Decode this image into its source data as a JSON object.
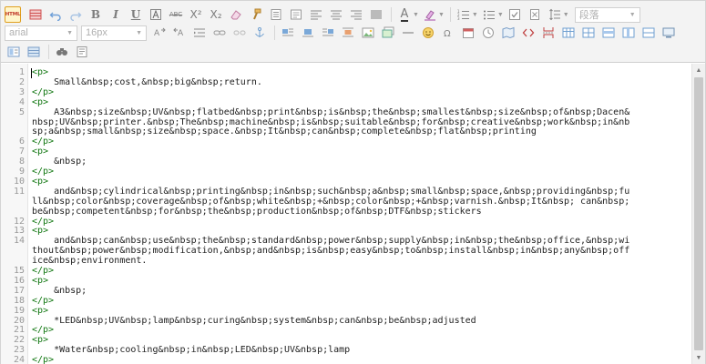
{
  "toolbar": {
    "html_label": "HTML",
    "font_family_value": "arial",
    "font_size_value": "16px",
    "paragraph_value": "段落",
    "row1_icons": [
      "table-icon",
      "undo-icon",
      "redo-icon",
      "bold-icon",
      "italic-icon",
      "underline-icon",
      "font-border-icon",
      "strikethrough-icon",
      "superscript-icon",
      "subscript-icon",
      "eraser-icon",
      "format-brush-icon",
      "auto-typeset-icon",
      "block-quote-icon",
      "align-left-icon",
      "align-center-icon",
      "align-right-icon",
      "align-justify-icon",
      "font-color-icon",
      "highlight-color-icon",
      "ordered-list-icon",
      "unordered-list-icon",
      "select-all-icon",
      "clear-doc-icon",
      "line-height-icon"
    ],
    "row1_glyphs": {
      "bold": "B",
      "italic": "I",
      "underline": "U",
      "strike": "ABC",
      "sup": "X²",
      "sub": "X₂",
      "fontcolor": "A"
    },
    "row2_icons": [
      "direction-ltr-icon",
      "direction-rtl-icon",
      "indent-icon",
      "link-icon",
      "unlink-icon",
      "anchor-icon",
      "image-left-icon",
      "image-none-icon",
      "image-right-icon",
      "image-center-icon",
      "insert-image-icon",
      "multi-image-icon",
      "horizontal-rule-icon",
      "emotion-icon",
      "special-char-icon",
      "date-icon",
      "time-icon",
      "map-icon",
      "insert-code-icon",
      "page-break-icon",
      "insert-table-icon",
      "delete-table-icon",
      "insert-row-icon",
      "insert-col-icon",
      "merge-cells-icon",
      "preview-icon"
    ],
    "row3_icons": [
      "template-icon",
      "background-icon",
      "search-replace-icon",
      "word-count-icon"
    ]
  },
  "code": {
    "line_numbers": [
      "1",
      "2",
      "3",
      "4",
      "5",
      "",
      "",
      "6",
      "7",
      "8",
      "9",
      "10",
      "11",
      "",
      "",
      "12",
      "13",
      "14",
      "",
      "",
      "15",
      "16",
      "17",
      "18",
      "19",
      "20",
      "21",
      "22",
      "23",
      "24"
    ],
    "lines": [
      {
        "kind": "tag",
        "text": "<p>"
      },
      {
        "kind": "txt",
        "text": "    Small&nbsp;cost,&nbsp;big&nbsp;return."
      },
      {
        "kind": "tag",
        "text": "</p>"
      },
      {
        "kind": "tag",
        "text": "<p>"
      },
      {
        "kind": "txt",
        "text": "    A3&nbsp;size&nbsp;UV&nbsp;flatbed&nbsp;print&nbsp;is&nbsp;the&nbsp;smallest&nbsp;size&nbsp;of&nbsp;Dacen&"
      },
      {
        "kind": "txt",
        "text": "nbsp;UV&nbsp;printer.&nbsp;The&nbsp;machine&nbsp;is&nbsp;suitable&nbsp;for&nbsp;creative&nbsp;work&nbsp;in&nb"
      },
      {
        "kind": "txt",
        "text": "sp;a&nbsp;small&nbsp;size&nbsp;space.&nbsp;It&nbsp;can&nbsp;complete&nbsp;flat&nbsp;printing"
      },
      {
        "kind": "tag",
        "text": "</p>"
      },
      {
        "kind": "tag",
        "text": "<p>"
      },
      {
        "kind": "txt",
        "text": "    &nbsp;"
      },
      {
        "kind": "tag",
        "text": "</p>"
      },
      {
        "kind": "tag",
        "text": "<p>"
      },
      {
        "kind": "txt",
        "text": "    and&nbsp;cylindrical&nbsp;printing&nbsp;in&nbsp;such&nbsp;a&nbsp;small&nbsp;space,&nbsp;providing&nbsp;fu"
      },
      {
        "kind": "txt",
        "text": "ll&nbsp;color&nbsp;coverage&nbsp;of&nbsp;white&nbsp;+&nbsp;color&nbsp;+&nbsp;varnish.&nbsp;It&nbsp; can&nbsp;"
      },
      {
        "kind": "txt",
        "text": "be&nbsp;competent&nbsp;for&nbsp;the&nbsp;production&nbsp;of&nbsp;DTF&nbsp;stickers"
      },
      {
        "kind": "tag",
        "text": "</p>"
      },
      {
        "kind": "tag",
        "text": "<p>"
      },
      {
        "kind": "txt",
        "text": "    and&nbsp;can&nbsp;use&nbsp;the&nbsp;standard&nbsp;power&nbsp;supply&nbsp;in&nbsp;the&nbsp;office,&nbsp;wi"
      },
      {
        "kind": "txt",
        "text": "thout&nbsp;power&nbsp;modification,&nbsp;and&nbsp;is&nbsp;easy&nbsp;to&nbsp;install&nbsp;in&nbsp;any&nbsp;off"
      },
      {
        "kind": "txt",
        "text": "ice&nbsp;environment."
      },
      {
        "kind": "tag",
        "text": "</p>"
      },
      {
        "kind": "tag",
        "text": "<p>"
      },
      {
        "kind": "txt",
        "text": "    &nbsp;"
      },
      {
        "kind": "tag",
        "text": "</p>"
      },
      {
        "kind": "tag",
        "text": "<p>"
      },
      {
        "kind": "txt",
        "text": "    *LED&nbsp;UV&nbsp;lamp&nbsp;curing&nbsp;system&nbsp;can&nbsp;be&nbsp;adjusted"
      },
      {
        "kind": "tag",
        "text": "</p>"
      },
      {
        "kind": "tag",
        "text": "<p>"
      },
      {
        "kind": "txt",
        "text": "    *Water&nbsp;cooling&nbsp;in&nbsp;LED&nbsp;UV&nbsp;lamp"
      },
      {
        "kind": "tag",
        "text": "</p>"
      }
    ]
  }
}
